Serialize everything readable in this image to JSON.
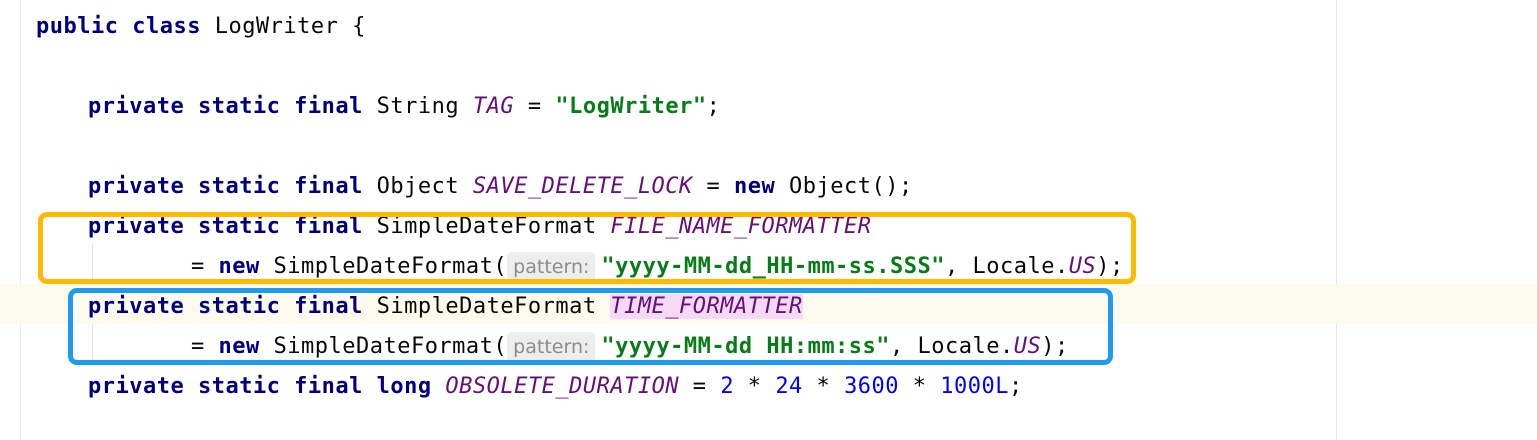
{
  "editor": {
    "line1": {
      "kw": "public class",
      "name": " LogWriter {"
    },
    "line2": {
      "kw": "private static final",
      "type": " String ",
      "field": "TAG",
      "eq": " = ",
      "str": "\"LogWriter\"",
      "end": ";"
    },
    "line3": {
      "kw1": "private static final",
      "type": " Object ",
      "field": "SAVE_DELETE_LOCK",
      "eq": " = ",
      "kw2": "new",
      "rest": " Object();"
    },
    "line4": {
      "kw": "private static final",
      "type": " SimpleDateFormat ",
      "field": "FILE_NAME_FORMATTER"
    },
    "line5": {
      "eq": "= ",
      "kw": "new",
      "call": " SimpleDateFormat(",
      "hint": "pattern:",
      "str": "\"yyyy-MM-dd_HH-mm-ss.SSS\"",
      "mid": ", Locale.",
      "field": "US",
      "end": ");"
    },
    "line6": {
      "kw": "private static final",
      "type": " SimpleDateFormat ",
      "field": "TIME_FORMATTER"
    },
    "line7": {
      "eq": "= ",
      "kw": "new",
      "call": " SimpleDateFormat(",
      "hint": "pattern:",
      "str": "\"yyyy-MM-dd HH:mm:ss\"",
      "mid": ", Locale.",
      "field": "US",
      "end": ");"
    },
    "line8": {
      "kw": "private static final long",
      "field": "OBSOLETE_DURATION",
      "eq": " = ",
      "n1": "2",
      "op1": " * ",
      "n2": "24",
      "op2": " * ",
      "n3": "3600",
      "op3": " * ",
      "n4": "1000L",
      "end": ";"
    }
  },
  "colors": {
    "keyword": "#000080",
    "field": "#660e7a",
    "string": "#067d17",
    "number": "#0000ff",
    "orange_box": "#ffb900",
    "blue_box": "#1e9bf0",
    "caret_row": "#fcfaed"
  }
}
